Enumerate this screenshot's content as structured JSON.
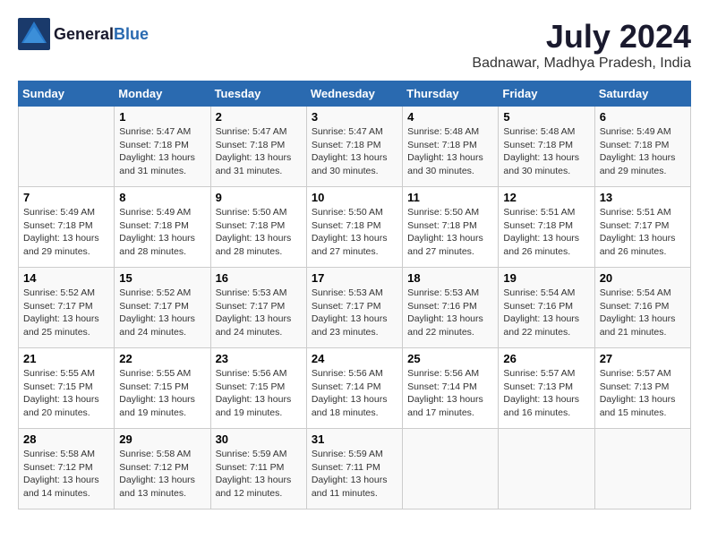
{
  "logo": {
    "general": "General",
    "blue": "Blue"
  },
  "title": {
    "month_year": "July 2024",
    "location": "Badnawar, Madhya Pradesh, India"
  },
  "days_of_week": [
    "Sunday",
    "Monday",
    "Tuesday",
    "Wednesday",
    "Thursday",
    "Friday",
    "Saturday"
  ],
  "weeks": [
    [
      {
        "day": "",
        "detail": ""
      },
      {
        "day": "1",
        "detail": "Sunrise: 5:47 AM\nSunset: 7:18 PM\nDaylight: 13 hours\nand 31 minutes."
      },
      {
        "day": "2",
        "detail": "Sunrise: 5:47 AM\nSunset: 7:18 PM\nDaylight: 13 hours\nand 31 minutes."
      },
      {
        "day": "3",
        "detail": "Sunrise: 5:47 AM\nSunset: 7:18 PM\nDaylight: 13 hours\nand 30 minutes."
      },
      {
        "day": "4",
        "detail": "Sunrise: 5:48 AM\nSunset: 7:18 PM\nDaylight: 13 hours\nand 30 minutes."
      },
      {
        "day": "5",
        "detail": "Sunrise: 5:48 AM\nSunset: 7:18 PM\nDaylight: 13 hours\nand 30 minutes."
      },
      {
        "day": "6",
        "detail": "Sunrise: 5:49 AM\nSunset: 7:18 PM\nDaylight: 13 hours\nand 29 minutes."
      }
    ],
    [
      {
        "day": "7",
        "detail": "Sunrise: 5:49 AM\nSunset: 7:18 PM\nDaylight: 13 hours\nand 29 minutes."
      },
      {
        "day": "8",
        "detail": "Sunrise: 5:49 AM\nSunset: 7:18 PM\nDaylight: 13 hours\nand 28 minutes."
      },
      {
        "day": "9",
        "detail": "Sunrise: 5:50 AM\nSunset: 7:18 PM\nDaylight: 13 hours\nand 28 minutes."
      },
      {
        "day": "10",
        "detail": "Sunrise: 5:50 AM\nSunset: 7:18 PM\nDaylight: 13 hours\nand 27 minutes."
      },
      {
        "day": "11",
        "detail": "Sunrise: 5:50 AM\nSunset: 7:18 PM\nDaylight: 13 hours\nand 27 minutes."
      },
      {
        "day": "12",
        "detail": "Sunrise: 5:51 AM\nSunset: 7:18 PM\nDaylight: 13 hours\nand 26 minutes."
      },
      {
        "day": "13",
        "detail": "Sunrise: 5:51 AM\nSunset: 7:17 PM\nDaylight: 13 hours\nand 26 minutes."
      }
    ],
    [
      {
        "day": "14",
        "detail": "Sunrise: 5:52 AM\nSunset: 7:17 PM\nDaylight: 13 hours\nand 25 minutes."
      },
      {
        "day": "15",
        "detail": "Sunrise: 5:52 AM\nSunset: 7:17 PM\nDaylight: 13 hours\nand 24 minutes."
      },
      {
        "day": "16",
        "detail": "Sunrise: 5:53 AM\nSunset: 7:17 PM\nDaylight: 13 hours\nand 24 minutes."
      },
      {
        "day": "17",
        "detail": "Sunrise: 5:53 AM\nSunset: 7:17 PM\nDaylight: 13 hours\nand 23 minutes."
      },
      {
        "day": "18",
        "detail": "Sunrise: 5:53 AM\nSunset: 7:16 PM\nDaylight: 13 hours\nand 22 minutes."
      },
      {
        "day": "19",
        "detail": "Sunrise: 5:54 AM\nSunset: 7:16 PM\nDaylight: 13 hours\nand 22 minutes."
      },
      {
        "day": "20",
        "detail": "Sunrise: 5:54 AM\nSunset: 7:16 PM\nDaylight: 13 hours\nand 21 minutes."
      }
    ],
    [
      {
        "day": "21",
        "detail": "Sunrise: 5:55 AM\nSunset: 7:15 PM\nDaylight: 13 hours\nand 20 minutes."
      },
      {
        "day": "22",
        "detail": "Sunrise: 5:55 AM\nSunset: 7:15 PM\nDaylight: 13 hours\nand 19 minutes."
      },
      {
        "day": "23",
        "detail": "Sunrise: 5:56 AM\nSunset: 7:15 PM\nDaylight: 13 hours\nand 19 minutes."
      },
      {
        "day": "24",
        "detail": "Sunrise: 5:56 AM\nSunset: 7:14 PM\nDaylight: 13 hours\nand 18 minutes."
      },
      {
        "day": "25",
        "detail": "Sunrise: 5:56 AM\nSunset: 7:14 PM\nDaylight: 13 hours\nand 17 minutes."
      },
      {
        "day": "26",
        "detail": "Sunrise: 5:57 AM\nSunset: 7:13 PM\nDaylight: 13 hours\nand 16 minutes."
      },
      {
        "day": "27",
        "detail": "Sunrise: 5:57 AM\nSunset: 7:13 PM\nDaylight: 13 hours\nand 15 minutes."
      }
    ],
    [
      {
        "day": "28",
        "detail": "Sunrise: 5:58 AM\nSunset: 7:12 PM\nDaylight: 13 hours\nand 14 minutes."
      },
      {
        "day": "29",
        "detail": "Sunrise: 5:58 AM\nSunset: 7:12 PM\nDaylight: 13 hours\nand 13 minutes."
      },
      {
        "day": "30",
        "detail": "Sunrise: 5:59 AM\nSunset: 7:11 PM\nDaylight: 13 hours\nand 12 minutes."
      },
      {
        "day": "31",
        "detail": "Sunrise: 5:59 AM\nSunset: 7:11 PM\nDaylight: 13 hours\nand 11 minutes."
      },
      {
        "day": "",
        "detail": ""
      },
      {
        "day": "",
        "detail": ""
      },
      {
        "day": "",
        "detail": ""
      }
    ]
  ]
}
